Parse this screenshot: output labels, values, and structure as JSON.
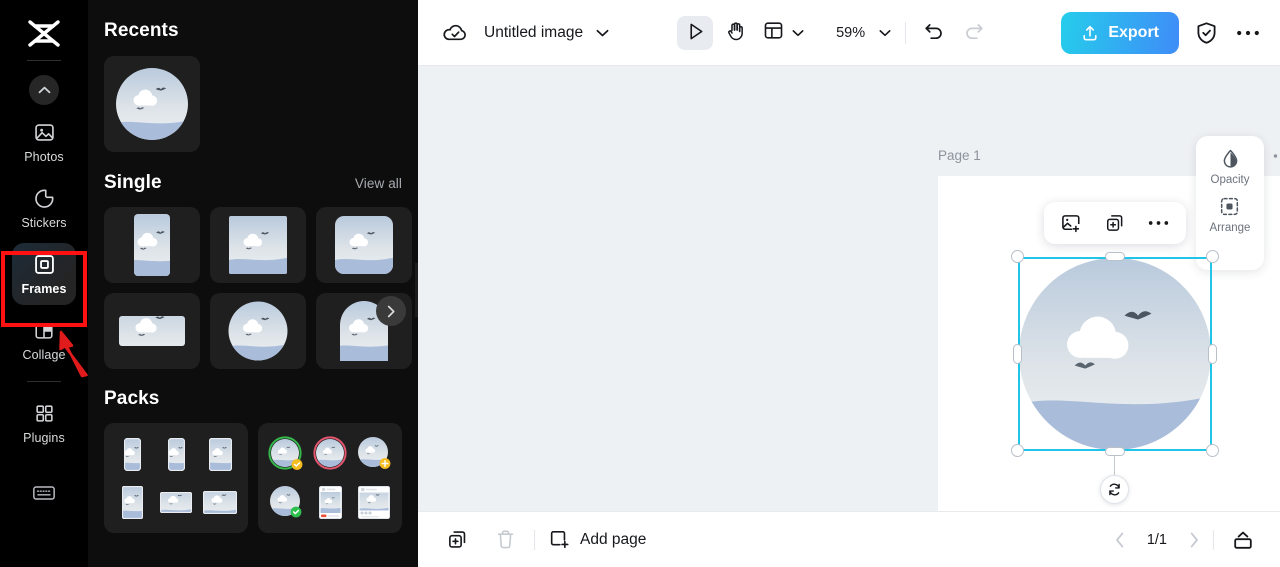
{
  "rail": {
    "logo_icon": "capcut-logo-icon",
    "collapse_icon": "chevron-up-icon",
    "items": [
      {
        "label": "Photos",
        "icon": "photos-icon",
        "active": false
      },
      {
        "label": "Stickers",
        "icon": "stickers-icon",
        "active": false
      },
      {
        "label": "Frames",
        "icon": "frames-icon",
        "active": true
      },
      {
        "label": "Collage",
        "icon": "collage-icon",
        "active": false
      },
      {
        "label": "Plugins",
        "icon": "plugins-icon",
        "active": false
      }
    ],
    "keyboard_icon": "keyboard-icon"
  },
  "panel": {
    "recents": {
      "title": "Recents",
      "items": [
        "circle-frame-thumb"
      ]
    },
    "single": {
      "title": "Single",
      "view_all": "View all",
      "items": [
        "portrait-frame-thumb",
        "square-frame-thumb",
        "rounded-square-frame-thumb",
        "landscape-frame-thumb",
        "circle-frame-thumb",
        "arch-frame-thumb"
      ]
    },
    "packs": {
      "title": "Packs",
      "items": [
        "device-mockups-pack",
        "social-frames-pack"
      ]
    },
    "next_arrow_icon": "chevron-right-icon",
    "collapse_handle_icon": "chevron-left-icon"
  },
  "topbar": {
    "cloud_icon": "cloud-saved-icon",
    "doc_title": "Untitled image",
    "title_caret_icon": "chevron-down-icon",
    "tools": [
      {
        "name": "select-tool",
        "icon": "cursor-arrow-icon",
        "selected": true
      },
      {
        "name": "hand-tool",
        "icon": "hand-icon",
        "selected": false
      }
    ],
    "layout_icon": "layout-icon",
    "layout_caret_icon": "chevron-down-icon",
    "zoom_value": "59%",
    "zoom_caret_icon": "chevron-down-icon",
    "undo_icon": "undo-icon",
    "redo_icon": "redo-icon",
    "export_label": "Export",
    "export_icon": "upload-icon",
    "shield_icon": "shield-check-icon",
    "more_icon": "more-horizontal-icon",
    "export_gradient_from": "#25cdeb",
    "export_gradient_to": "#3f8cf8"
  },
  "canvas": {
    "page_label": "Page 1",
    "page_header_icons": [
      "image-layers-icon",
      "more-horizontal-icon"
    ],
    "floating_toolbar": [
      {
        "name": "replace-image-button",
        "icon": "image-plus-icon"
      },
      {
        "name": "duplicate-button",
        "icon": "copy-plus-icon"
      },
      {
        "name": "more-options-button",
        "icon": "more-horizontal-icon"
      }
    ],
    "selection_color": "#22c5e8",
    "rotate_icon": "rotate-icon",
    "right_panel": [
      {
        "label": "Opacity",
        "icon": "opacity-droplet-icon"
      },
      {
        "label": "Arrange",
        "icon": "arrange-icon"
      }
    ]
  },
  "bottombar": {
    "duplicate_page_icon": "copy-plus-icon",
    "delete_page_icon": "trash-icon",
    "add_page_label": "Add page",
    "add_page_icon": "square-plus-icon",
    "prev_icon": "chevron-left-icon",
    "page_counter": "1/1",
    "next_icon": "chevron-right-icon",
    "pages_panel_icon": "pages-panel-icon"
  },
  "annotation": {
    "highlight_target": "Frames",
    "highlight_color": "#ff1111",
    "arrow_color": "#e01b1b"
  }
}
